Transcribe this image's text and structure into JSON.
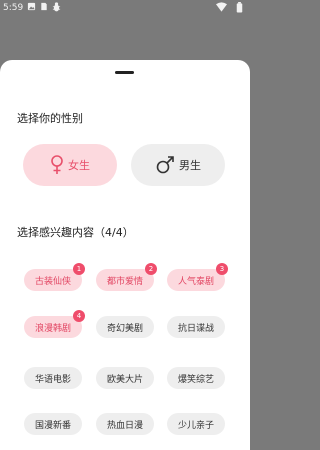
{
  "status_bar": {
    "time": "5:59",
    "icons": [
      "image-icon",
      "sim-icon",
      "bug-icon",
      "wifi-icon",
      "battery-icon"
    ]
  },
  "sheet": {
    "gender_title": "选择你的性别",
    "gender_options": [
      {
        "label": "女生",
        "icon": "female-icon",
        "selected": true
      },
      {
        "label": "男生",
        "icon": "male-icon",
        "selected": false
      }
    ],
    "interest_title": "选择感兴趣内容（4/4）",
    "interests": [
      {
        "label": "古装仙侠",
        "selected": true,
        "badge": "1"
      },
      {
        "label": "都市爱情",
        "selected": true,
        "badge": "2"
      },
      {
        "label": "人气泰剧",
        "selected": true,
        "badge": "3"
      },
      {
        "label": "浪漫韩剧",
        "selected": true,
        "badge": "4"
      },
      {
        "label": "奇幻美剧",
        "selected": false,
        "badge": ""
      },
      {
        "label": "抗日谍战",
        "selected": false,
        "badge": ""
      },
      {
        "label": "华语电影",
        "selected": false,
        "badge": ""
      },
      {
        "label": "欧美大片",
        "selected": false,
        "badge": ""
      },
      {
        "label": "爆笑综艺",
        "selected": false,
        "badge": ""
      },
      {
        "label": "国漫新番",
        "selected": false,
        "badge": ""
      },
      {
        "label": "热血日漫",
        "selected": false,
        "badge": ""
      },
      {
        "label": "少儿亲子",
        "selected": false,
        "badge": ""
      }
    ]
  },
  "colors": {
    "accent": "#e8506b",
    "selected_bg": "#fcd9de",
    "unselected_bg": "#eeeeee",
    "badge": "#ef4d6b",
    "backdrop": "#7a7a7a"
  }
}
